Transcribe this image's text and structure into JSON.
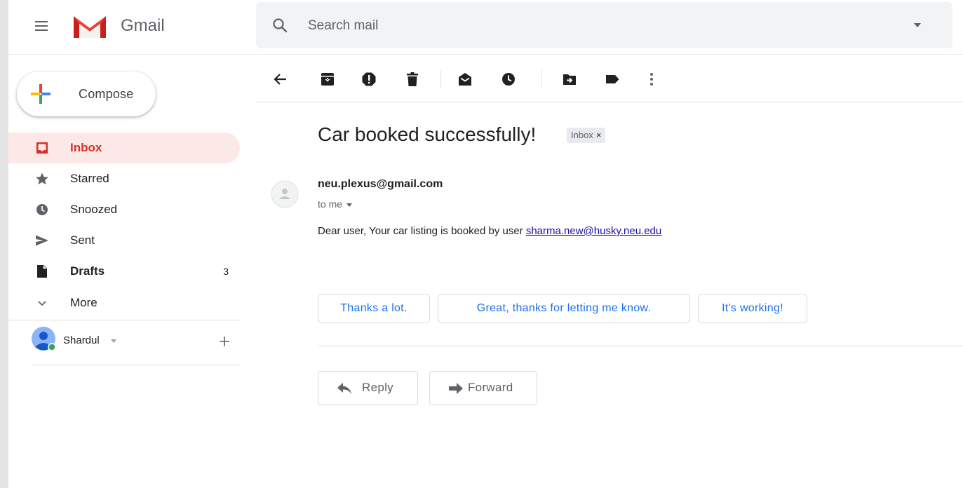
{
  "app": {
    "name": "Gmail"
  },
  "search": {
    "placeholder": "Search mail"
  },
  "compose": {
    "label": "Compose"
  },
  "nav": [
    {
      "label": "Inbox",
      "icon": "inbox-icon",
      "active": true
    },
    {
      "label": "Starred",
      "icon": "star-icon"
    },
    {
      "label": "Snoozed",
      "icon": "clock-icon"
    },
    {
      "label": "Sent",
      "icon": "send-icon"
    },
    {
      "label": "Drafts",
      "icon": "draft-icon",
      "count": "3"
    },
    {
      "label": "More",
      "icon": "chevron-down-icon"
    }
  ],
  "account": {
    "name": "Shardul",
    "status_color": "#34a853"
  },
  "toolbar": [
    "back-arrow-icon",
    "archive-icon",
    "report-spam-icon",
    "delete-icon",
    "mark-unread-icon",
    "snooze-icon",
    "move-to-icon",
    "label-icon",
    "more-vert-icon"
  ],
  "message": {
    "subject": "Car booked successfully!",
    "label_chip": "Inbox",
    "label_close": "×",
    "sender": "neu.plexus@gmail.com",
    "recipient": "to me",
    "body_text": "Dear user, Your car listing is booked by user ",
    "body_link": "sharma.new@husky.neu.edu"
  },
  "smart_replies": [
    "Thanks a lot.",
    "Great, thanks for letting me know.",
    "It's working!"
  ],
  "actions": {
    "reply": "Reply",
    "forward": "Forward"
  },
  "colors": {
    "accent_red": "#d93025",
    "inbox_bg": "#fce8e6",
    "link_blue": "#1a73e8"
  }
}
